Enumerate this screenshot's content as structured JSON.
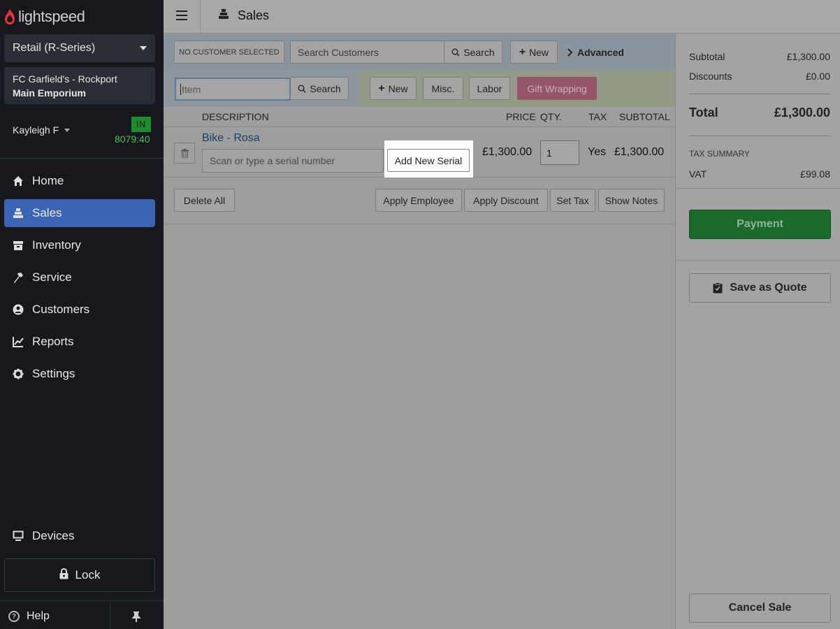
{
  "brand": {
    "name": "lightspeed",
    "accent": "#e8372d"
  },
  "sidebar": {
    "store": "Retail (R-Series)",
    "location_line1": "FC Garfield's - Rockport",
    "location_line2": "Main Emporium",
    "user": "Kayleigh F",
    "clock_status": "IN",
    "timer": "8079:40",
    "nav": [
      {
        "label": "Home",
        "icon": "home-icon"
      },
      {
        "label": "Sales",
        "icon": "register-icon",
        "active": true
      },
      {
        "label": "Inventory",
        "icon": "inventory-icon"
      },
      {
        "label": "Service",
        "icon": "hammer-icon"
      },
      {
        "label": "Customers",
        "icon": "user-circle-icon"
      },
      {
        "label": "Reports",
        "icon": "chart-line-icon"
      },
      {
        "label": "Settings",
        "icon": "gear-icon"
      }
    ],
    "devices": "Devices",
    "lock": "Lock",
    "help": "Help"
  },
  "header": {
    "title": "Sales"
  },
  "customer": {
    "none_label": "NO CUSTOMER SELECTED",
    "search_placeholder": "Search Customers",
    "search_btn": "Search",
    "new_btn": "New",
    "advanced": "Advanced"
  },
  "item_bar": {
    "placeholder": "Item",
    "search_btn": "Search",
    "new_btn": "New",
    "misc_btn": "Misc.",
    "labor_btn": "Labor",
    "gift_btn": "Gift Wrapping"
  },
  "table": {
    "headers": {
      "description": "DESCRIPTION",
      "price": "PRICE",
      "qty": "QTY.",
      "tax": "TAX",
      "subtotal": "SUBTOTAL"
    },
    "line": {
      "name": "Bike - Rosa",
      "serial_placeholder": "Scan or type a serial number",
      "serial_btn": "Add New Serial",
      "price": "£1,300.00",
      "qty": "1",
      "tax": "Yes",
      "subtotal": "£1,300.00"
    }
  },
  "actions": {
    "delete_all": "Delete All",
    "apply_employee": "Apply Employee",
    "apply_discount": "Apply Discount",
    "set_tax": "Set Tax",
    "show_notes": "Show Notes"
  },
  "summary": {
    "subtotal_label": "Subtotal",
    "subtotal": "£1,300.00",
    "discounts_label": "Discounts",
    "discounts": "£0.00",
    "total_label": "Total",
    "total": "£1,300.00",
    "tax_summary_label": "TAX SUMMARY",
    "vat_label": "VAT",
    "vat": "£99.08",
    "payment": "Payment",
    "save_quote": "Save as Quote",
    "cancel_sale": "Cancel Sale"
  }
}
